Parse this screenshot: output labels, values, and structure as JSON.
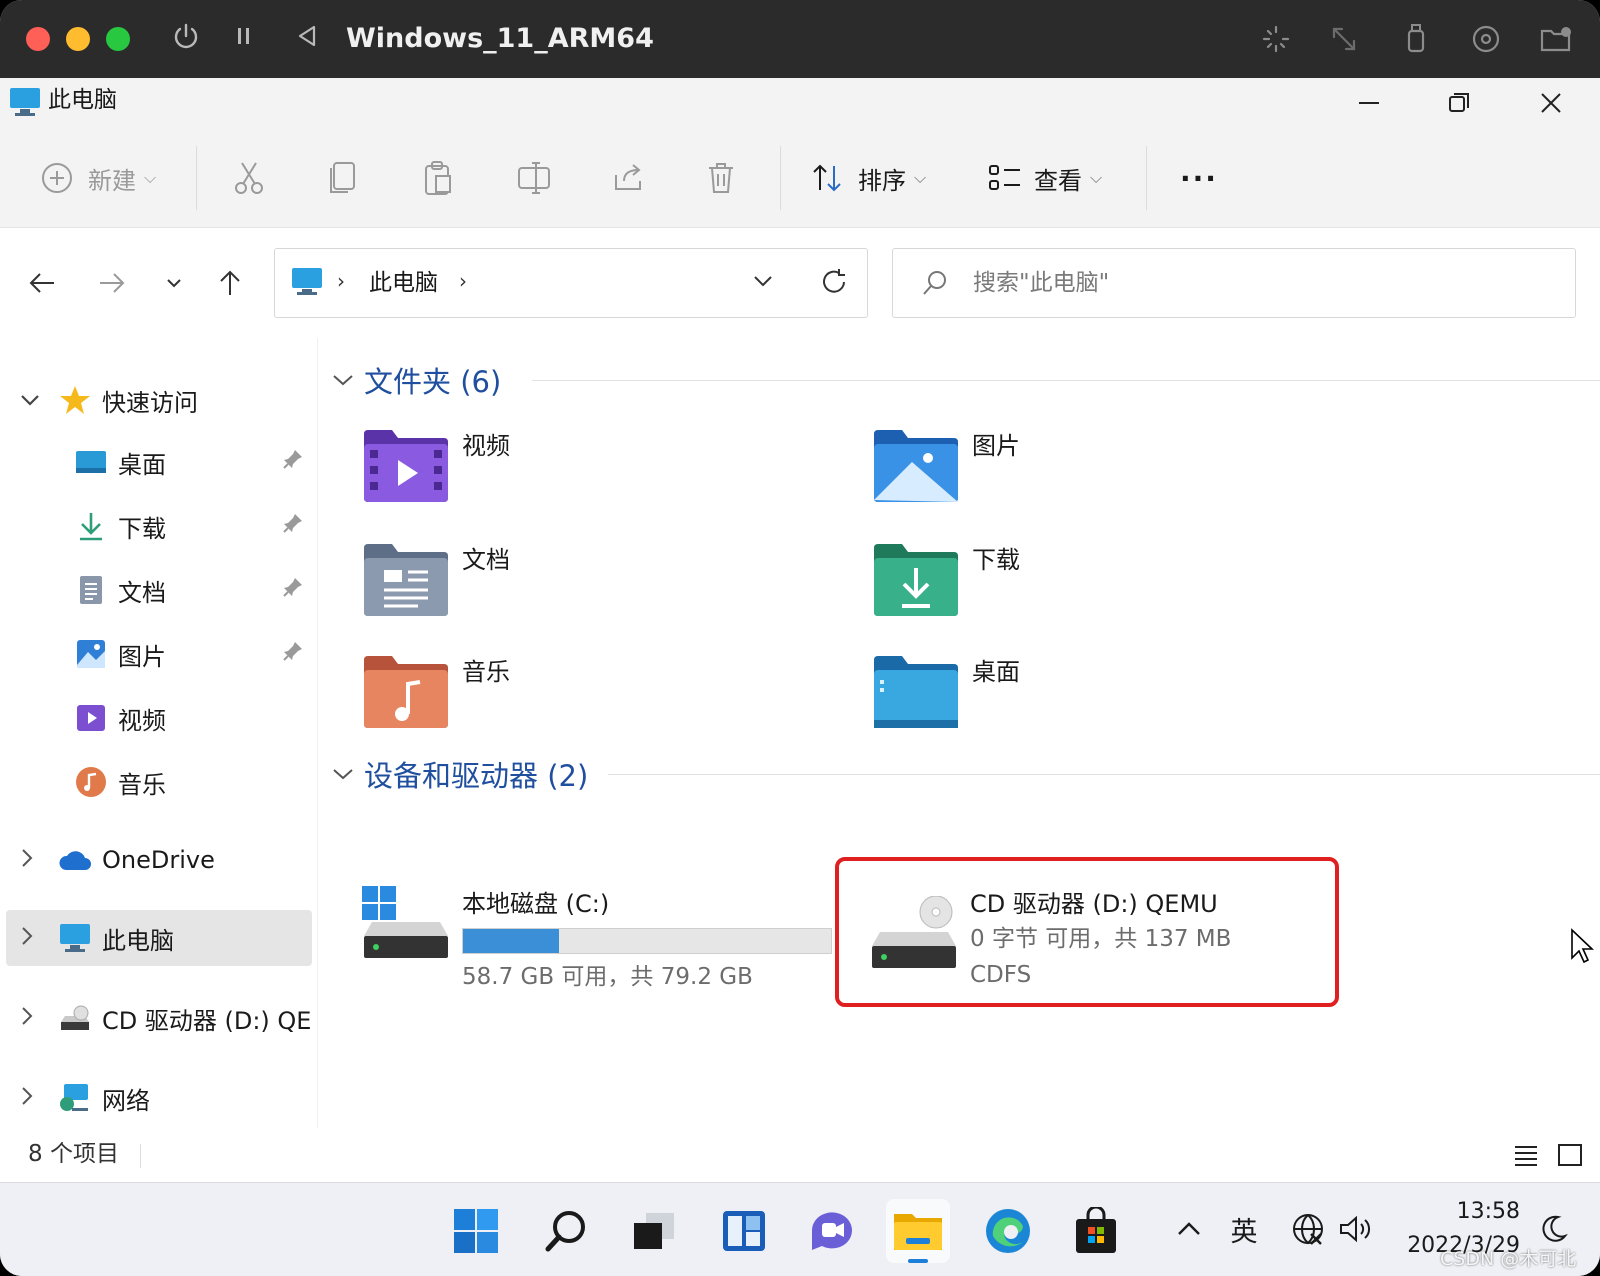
{
  "mac": {
    "title": "Windows_11_ARM64",
    "controls": [
      "power-icon",
      "pause-icon",
      "back-icon"
    ],
    "right_icons": [
      "capture-icon",
      "resize-icon",
      "usb-icon",
      "disc-icon",
      "folder-icon"
    ]
  },
  "window": {
    "title": "此电脑",
    "buttons": [
      "minimize-icon",
      "restore-icon",
      "close-icon"
    ]
  },
  "toolbar": {
    "new_label": "新建",
    "sort_label": "排序",
    "view_label": "查看",
    "more_label": "···"
  },
  "nav": {
    "address_crumb": "此电脑",
    "search_placeholder": "搜索\"此电脑\""
  },
  "sidebar": {
    "quick_access": "快速访问",
    "items": [
      {
        "label": "桌面",
        "pinned": true
      },
      {
        "label": "下载",
        "pinned": true
      },
      {
        "label": "文档",
        "pinned": true
      },
      {
        "label": "图片",
        "pinned": true
      },
      {
        "label": "视频",
        "pinned": false
      },
      {
        "label": "音乐",
        "pinned": false
      }
    ],
    "onedrive": "OneDrive",
    "thispc": "此电脑",
    "cd": "CD 驱动器 (D:) QEMU",
    "network": "网络"
  },
  "folders": {
    "header": "文件夹 (6)",
    "items": [
      {
        "label": "视频",
        "color": "#7b4fd0"
      },
      {
        "label": "图片",
        "color": "#2f7fd6"
      },
      {
        "label": "文档",
        "color": "#7a8aa3"
      },
      {
        "label": "下载",
        "color": "#2f9d7a"
      },
      {
        "label": "音乐",
        "color": "#e07a4a"
      },
      {
        "label": "桌面",
        "color": "#2a9ad6"
      }
    ]
  },
  "drives": {
    "header": "设备和驱动器 (2)",
    "c": {
      "name": "本地磁盘 (C:)",
      "info": "58.7 GB 可用，共 79.2 GB",
      "used_fraction": 0.26
    },
    "d": {
      "name": "CD 驱动器 (D:) QEMU",
      "info": "0 字节 可用，共 137 MB",
      "fs": "CDFS"
    }
  },
  "status": {
    "count": "8 个项目"
  },
  "taskbar": {
    "apps": [
      "windows-icon",
      "search-icon",
      "taskview-icon",
      "widgets-icon",
      "chat-icon",
      "explorer-icon",
      "edge-icon",
      "store-icon"
    ],
    "ime": "英",
    "time": "13:58",
    "date": "2022/3/29"
  },
  "watermark": "CSDN @木可北"
}
